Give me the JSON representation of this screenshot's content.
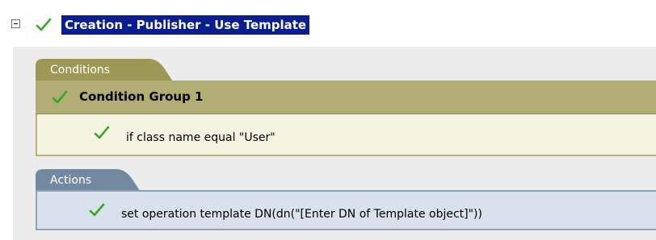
{
  "rule": {
    "title": "Creation - Publisher - Use Template"
  },
  "conditions": {
    "tab_label": "Conditions",
    "group_label": "Condition Group 1",
    "items": [
      {
        "text": "if class name equal \"User\""
      }
    ]
  },
  "actions": {
    "tab_label": "Actions",
    "items": [
      {
        "text": "set operation template DN(dn(\"[Enter DN of Template object]\"))"
      }
    ]
  },
  "colors": {
    "selection_bg": "#0b1e8f",
    "check_green": "#3aa52a",
    "conditions_tab": "#9c9856",
    "actions_tab": "#7389a0"
  }
}
